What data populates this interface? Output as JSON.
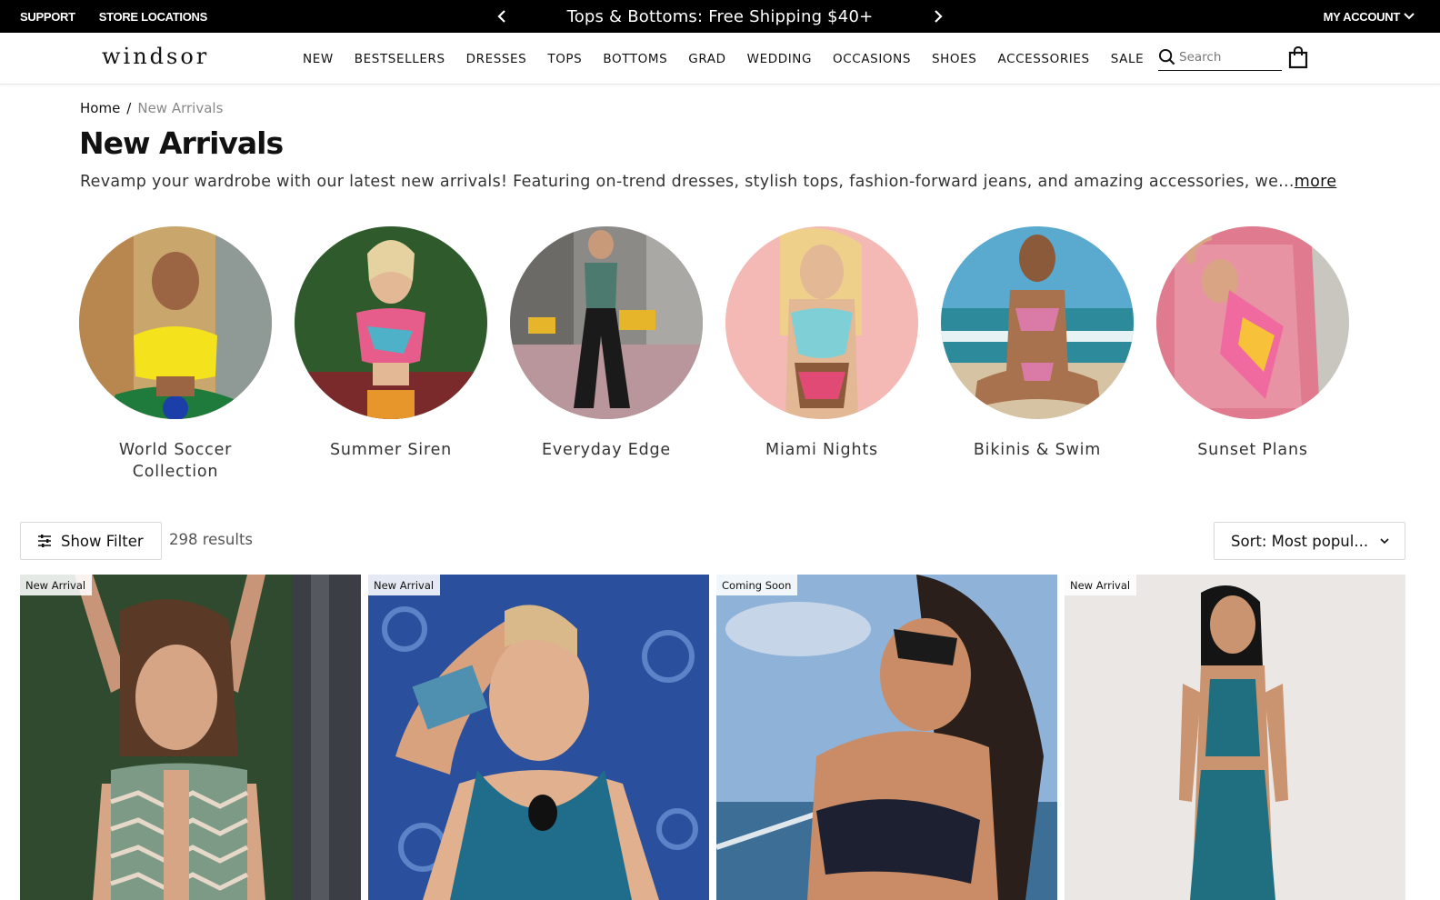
{
  "topbar": {
    "support": "SUPPORT",
    "store_locations": "STORE LOCATIONS",
    "promo": "Tops & Bottoms: Free Shipping $40+",
    "account": "MY ACCOUNT"
  },
  "header": {
    "logo": "windsor",
    "nav": [
      "NEW",
      "BESTSELLERS",
      "DRESSES",
      "TOPS",
      "BOTTOMS",
      "GRAD",
      "WEDDING",
      "OCCASIONS",
      "SHOES",
      "ACCESSORIES",
      "SALE"
    ],
    "search_placeholder": "Search"
  },
  "breadcrumb": {
    "home": "Home",
    "separator": "/",
    "current": "New Arrivals"
  },
  "page": {
    "title": "New Arrivals",
    "description": "Revamp your wardrobe with our latest new arrivals! Featuring on-trend dresses, stylish tops, fashion-forward jeans, and amazing accessories, we...",
    "more": "more"
  },
  "categories": [
    {
      "label": "World Soccer Collection"
    },
    {
      "label": "Summer Siren"
    },
    {
      "label": "Everyday Edge"
    },
    {
      "label": "Miami Nights"
    },
    {
      "label": "Bikinis & Swim"
    },
    {
      "label": "Sunset Plans"
    }
  ],
  "toolbar": {
    "filter_label": "Show Filter",
    "results": "298 results",
    "sort_label": "Sort: Most popul..."
  },
  "products": [
    {
      "badge": "New Arrival"
    },
    {
      "badge": "New Arrival"
    },
    {
      "badge": "Coming Soon"
    },
    {
      "badge": "New Arrival"
    }
  ],
  "colors": {
    "topbar_bg": "#000000",
    "text": "#111111",
    "muted": "#888888",
    "border": "#d8d8d8"
  },
  "icons": [
    "chevron-left-icon",
    "chevron-right-icon",
    "chevron-down-icon",
    "search-icon",
    "shopping-bag-icon",
    "filter-sliders-icon"
  ]
}
